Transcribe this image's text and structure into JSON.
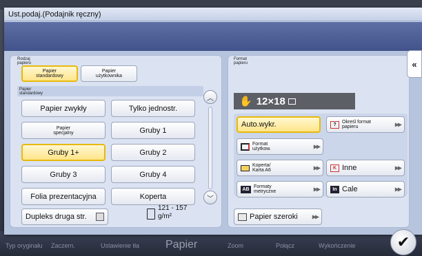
{
  "background": {
    "tabs": [
      "Typ oryginału",
      "Zaczern.",
      "Ustawienie tła",
      "Papier",
      "Zoom",
      "Połącz",
      "Wykończenie"
    ]
  },
  "dialog": {
    "title": "Ust.podaj.(Podajnik ręczny)"
  },
  "paper_type": {
    "section_label": "Rodzaj\npapieru",
    "tabs": [
      {
        "label": "Papier\nstandardowy",
        "selected": true
      },
      {
        "label": "Papier\nużytkownika",
        "selected": false
      }
    ],
    "list_label": "Papier\nstandardowy",
    "items": [
      {
        "label": "Papier zwykły",
        "selected": false
      },
      {
        "label": "Tylko jednostr.",
        "selected": false
      },
      {
        "label": "Papier\nspecjalny",
        "selected": false
      },
      {
        "label": "Gruby 1",
        "selected": false
      },
      {
        "label": "Gruby 1+",
        "selected": true
      },
      {
        "label": "Gruby 2",
        "selected": false
      },
      {
        "label": "Gruby 3",
        "selected": false
      },
      {
        "label": "Gruby 4",
        "selected": false
      },
      {
        "label": "Folia prezentacyjna",
        "selected": false
      },
      {
        "label": "Koperta",
        "selected": false
      }
    ],
    "duplex_label": "Dupleks druga str.",
    "duplex_checked": false,
    "weight_range": "121 - 157",
    "weight_unit": "g/m²"
  },
  "paper_size": {
    "section_label": "Format\npapieru",
    "current_size": "12×18",
    "buttons": {
      "auto": "Auto.wykr.",
      "specify": "Określ format\npapieru",
      "custom": "Format\nużytkow.",
      "envelope": "Koperta/\nKarta A6",
      "other": "Inne",
      "inch": "Cale",
      "metric": "Formaty\nmetryczne",
      "wide": "Papier szeroki"
    },
    "icon_letters": {
      "specify": "?",
      "other": "K",
      "inch": "In",
      "metric": "AB"
    }
  },
  "colors": {
    "selected_fill": "#ffe58a",
    "selected_border": "#e8b90a",
    "title_bar": "#d6dff0",
    "blue_strip": "#4d5e96",
    "size_bar": "#5c5f66"
  }
}
